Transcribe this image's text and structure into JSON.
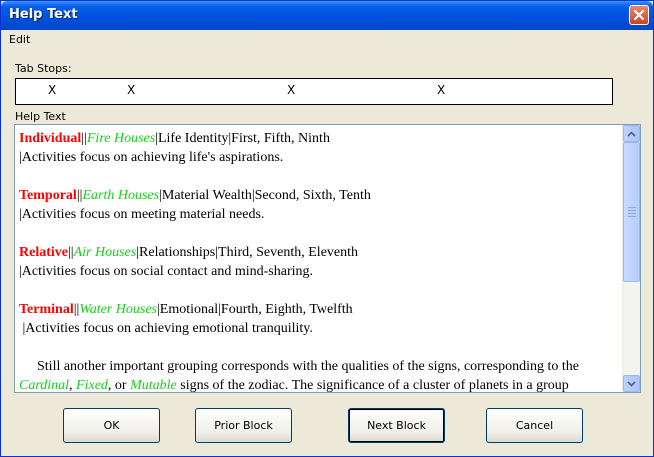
{
  "window": {
    "title": "Help Text"
  },
  "menu": {
    "edit": "Edit"
  },
  "tab_stops": {
    "label": "Tab Stops:",
    "markers": [
      "X",
      "X",
      "X",
      "X"
    ]
  },
  "help_text": {
    "label": "Help Text",
    "blocks": [
      {
        "term": "Individual",
        "sep1": "||",
        "house": "Fire Houses",
        "rest": "|Life Identity|First, Fifth, Ninth",
        "line2": "|Activities focus on achieving life's aspirations."
      },
      {
        "term": "Temporal",
        "sep1": "||",
        "house": "Earth Houses",
        "rest": "|Material Wealth|Second, Sixth, Tenth",
        "line2": "|Activities focus on meeting material needs."
      },
      {
        "term": "Relative",
        "sep1": "||",
        "house": "Air Houses",
        "rest": "|Relationships|Third, Seventh, Eleventh",
        "line2": "|Activities focus on social contact and mind-sharing."
      },
      {
        "term": "Terminal",
        "sep1": "||",
        "house": "Water Houses",
        "rest": "|Emotional|Fourth, Eighth, Twelfth",
        "line2": " |Activities focus on achieving emotional tranquility."
      }
    ],
    "paragraph": {
      "line1": "Still another important grouping corresponds with the qualities of the signs, corresponding to the",
      "cardinal": "Cardinal",
      "comma1": ", ",
      "fixed": "Fixed",
      "or": ", or ",
      "mutable": "Mutable",
      "line2_rest": " signs of the zodiac. The significance of a cluster of planets in a group"
    }
  },
  "buttons": {
    "ok": "OK",
    "prior": "Prior Block",
    "next": "Next Block",
    "cancel": "Cancel"
  }
}
